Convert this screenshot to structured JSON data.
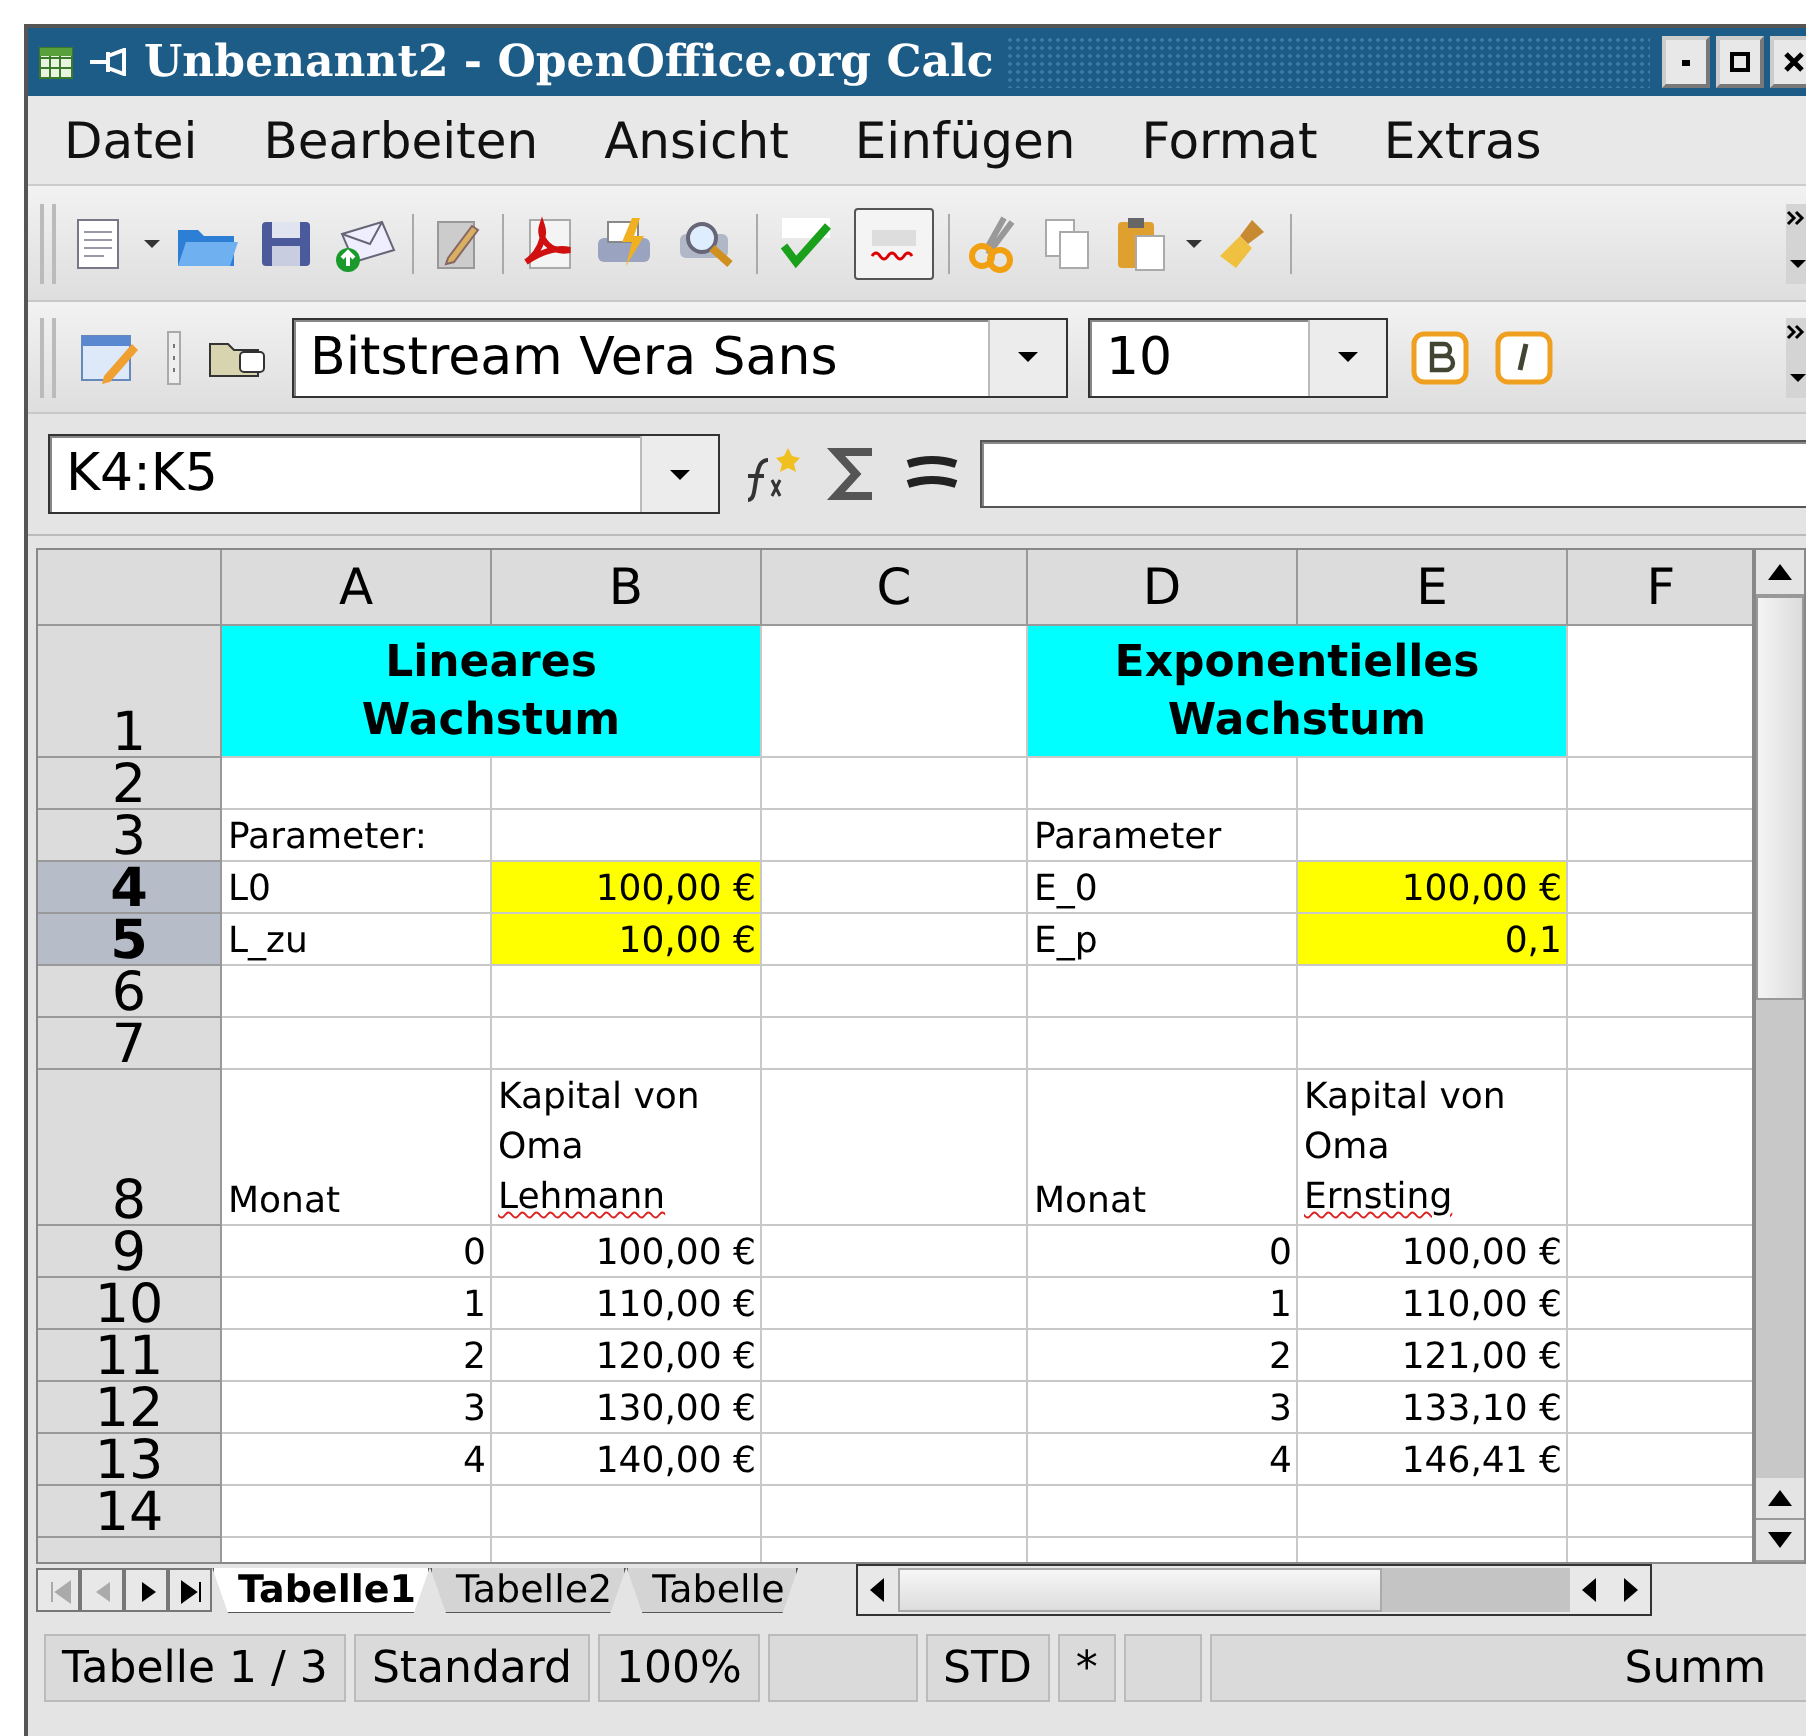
{
  "window": {
    "title": "Unbenannt2 - OpenOffice.org Calc"
  },
  "menu": [
    "Datei",
    "Bearbeiten",
    "Ansicht",
    "Einfügen",
    "Format",
    "Extras"
  ],
  "toolbar": {
    "auto_spellcheck_on": true
  },
  "font_box": {
    "value": "Bitstream Vera Sans"
  },
  "size_box": {
    "value": "10"
  },
  "name_box": {
    "value": "K4:K5"
  },
  "columns": [
    {
      "label": "A",
      "selected": false
    },
    {
      "label": "B",
      "selected": false
    },
    {
      "label": "C",
      "selected": false
    },
    {
      "label": "D",
      "selected": false
    },
    {
      "label": "E",
      "selected": false
    },
    {
      "label": "F",
      "selected": false
    }
  ],
  "rows": [
    {
      "label": "1",
      "selected": false,
      "cells": [
        {
          "kind": "title-wide",
          "text": "Lineares Wachstum"
        },
        {
          "kind": "empty"
        },
        {
          "kind": "title-wide",
          "text": "Exponentielles Wachstum"
        },
        {
          "kind": "empty"
        }
      ]
    },
    {
      "label": "2",
      "selected": false,
      "cells": [
        {
          "kind": "empty"
        },
        {
          "kind": "empty"
        },
        {
          "kind": "empty"
        },
        {
          "kind": "empty"
        },
        {
          "kind": "empty"
        },
        {
          "kind": "empty"
        }
      ]
    },
    {
      "label": "3",
      "selected": false,
      "cells": [
        {
          "kind": "text",
          "text": "Parameter:"
        },
        {
          "kind": "empty"
        },
        {
          "kind": "empty"
        },
        {
          "kind": "text",
          "text": "Parameter"
        },
        {
          "kind": "empty"
        },
        {
          "kind": "empty"
        }
      ]
    },
    {
      "label": "4",
      "selected": true,
      "cells": [
        {
          "kind": "text",
          "text": "L0"
        },
        {
          "kind": "input",
          "text": "100,00 €"
        },
        {
          "kind": "empty"
        },
        {
          "kind": "text",
          "text": "E_0"
        },
        {
          "kind": "input",
          "text": "100,00 €"
        },
        {
          "kind": "empty"
        }
      ]
    },
    {
      "label": "5",
      "selected": true,
      "cells": [
        {
          "kind": "text",
          "text": "L_zu"
        },
        {
          "kind": "input",
          "text": "10,00 €"
        },
        {
          "kind": "empty"
        },
        {
          "kind": "text",
          "text": "E_p"
        },
        {
          "kind": "input",
          "text": "0,1"
        },
        {
          "kind": "empty"
        }
      ]
    },
    {
      "label": "6",
      "selected": false,
      "cells": [
        {
          "kind": "empty"
        },
        {
          "kind": "empty"
        },
        {
          "kind": "empty"
        },
        {
          "kind": "empty"
        },
        {
          "kind": "empty"
        },
        {
          "kind": "empty"
        }
      ]
    },
    {
      "label": "7",
      "selected": false,
      "cells": [
        {
          "kind": "empty"
        },
        {
          "kind": "empty"
        },
        {
          "kind": "empty"
        },
        {
          "kind": "empty"
        },
        {
          "kind": "empty"
        },
        {
          "kind": "empty"
        }
      ]
    },
    {
      "label": "8",
      "selected": false,
      "cells": [
        {
          "kind": "text",
          "text": "Monat"
        },
        {
          "kind": "lines",
          "lines": [
            {
              "text": "Kapital von",
              "misspelled": false
            },
            {
              "text": "Oma",
              "misspelled": false
            },
            {
              "text": "Lehmann",
              "misspelled": true
            }
          ]
        },
        {
          "kind": "empty"
        },
        {
          "kind": "text",
          "text": "Monat"
        },
        {
          "kind": "lines",
          "lines": [
            {
              "text": "Kapital von",
              "misspelled": false
            },
            {
              "text": "Oma",
              "misspelled": false
            },
            {
              "text": "Ernsting",
              "misspelled": true
            }
          ]
        },
        {
          "kind": "empty"
        }
      ]
    },
    {
      "label": "9",
      "selected": false,
      "cells": [
        {
          "kind": "number",
          "text": "0"
        },
        {
          "kind": "number",
          "text": "100,00 €"
        },
        {
          "kind": "empty"
        },
        {
          "kind": "number",
          "text": "0"
        },
        {
          "kind": "number",
          "text": "100,00 €"
        },
        {
          "kind": "empty"
        }
      ]
    },
    {
      "label": "10",
      "selected": false,
      "cells": [
        {
          "kind": "number",
          "text": "1"
        },
        {
          "kind": "number",
          "text": "110,00 €"
        },
        {
          "kind": "empty"
        },
        {
          "kind": "number",
          "text": "1"
        },
        {
          "kind": "number",
          "text": "110,00 €"
        },
        {
          "kind": "empty"
        }
      ]
    },
    {
      "label": "11",
      "selected": false,
      "cells": [
        {
          "kind": "number",
          "text": "2"
        },
        {
          "kind": "number",
          "text": "120,00 €"
        },
        {
          "kind": "empty"
        },
        {
          "kind": "number",
          "text": "2"
        },
        {
          "kind": "number",
          "text": "121,00 €"
        },
        {
          "kind": "empty"
        }
      ]
    },
    {
      "label": "12",
      "selected": false,
      "cells": [
        {
          "kind": "number",
          "text": "3"
        },
        {
          "kind": "number",
          "text": "130,00 €"
        },
        {
          "kind": "empty"
        },
        {
          "kind": "number",
          "text": "3"
        },
        {
          "kind": "number",
          "text": "133,10 €"
        },
        {
          "kind": "empty"
        }
      ]
    },
    {
      "label": "13",
      "selected": false,
      "cells": [
        {
          "kind": "number",
          "text": "4"
        },
        {
          "kind": "number",
          "text": "140,00 €"
        },
        {
          "kind": "empty"
        },
        {
          "kind": "number",
          "text": "4"
        },
        {
          "kind": "number",
          "text": "146,41 €"
        },
        {
          "kind": "empty"
        }
      ]
    },
    {
      "label": "14",
      "selected": false,
      "cells": [
        {
          "kind": "empty"
        },
        {
          "kind": "empty"
        },
        {
          "kind": "empty"
        },
        {
          "kind": "empty"
        },
        {
          "kind": "empty"
        },
        {
          "kind": "empty"
        }
      ]
    }
  ],
  "sheet_tabs": [
    {
      "label": "Tabelle1",
      "selected": true
    },
    {
      "label": "Tabelle2",
      "selected": false
    },
    {
      "label": "Tabelle",
      "selected": false
    }
  ],
  "status_bar": [
    {
      "kind": "text",
      "text": "Tabelle 1 / 3"
    },
    {
      "kind": "text",
      "text": "Standard"
    },
    {
      "kind": "text",
      "text": "100%"
    },
    {
      "kind": "blank"
    },
    {
      "kind": "text",
      "text": "STD"
    },
    {
      "kind": "text",
      "text": "*"
    },
    {
      "kind": "blank"
    },
    {
      "kind": "sum",
      "text": "Summ"
    }
  ]
}
